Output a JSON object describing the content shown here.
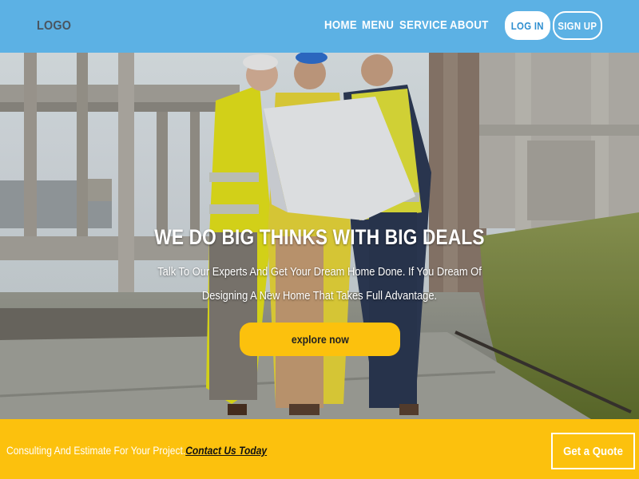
{
  "header": {
    "logo": "LOGO",
    "nav": [
      "HOME",
      "MENU",
      "SERVICE",
      "ABOUT"
    ],
    "login_label": "LOG IN",
    "signup_label": "SIGN UP",
    "background_color": "#5cb1e4"
  },
  "hero": {
    "title": "WE DO BIG THINKS WITH BIG DEALS",
    "subtitle_line1": "Talk To Our Experts And Get Your Dream Home Done. If You Dream Of",
    "subtitle_line2": "Designing A New Home That Takes Full Advantage.",
    "cta_label": "explore now",
    "accent_color": "#fcc10d"
  },
  "cta_band": {
    "text": "Consulting And Estimate For Your Project.",
    "link_label": "Contact Us Today",
    "button_label": "Get a Quote",
    "background_color": "#fcc10d"
  }
}
